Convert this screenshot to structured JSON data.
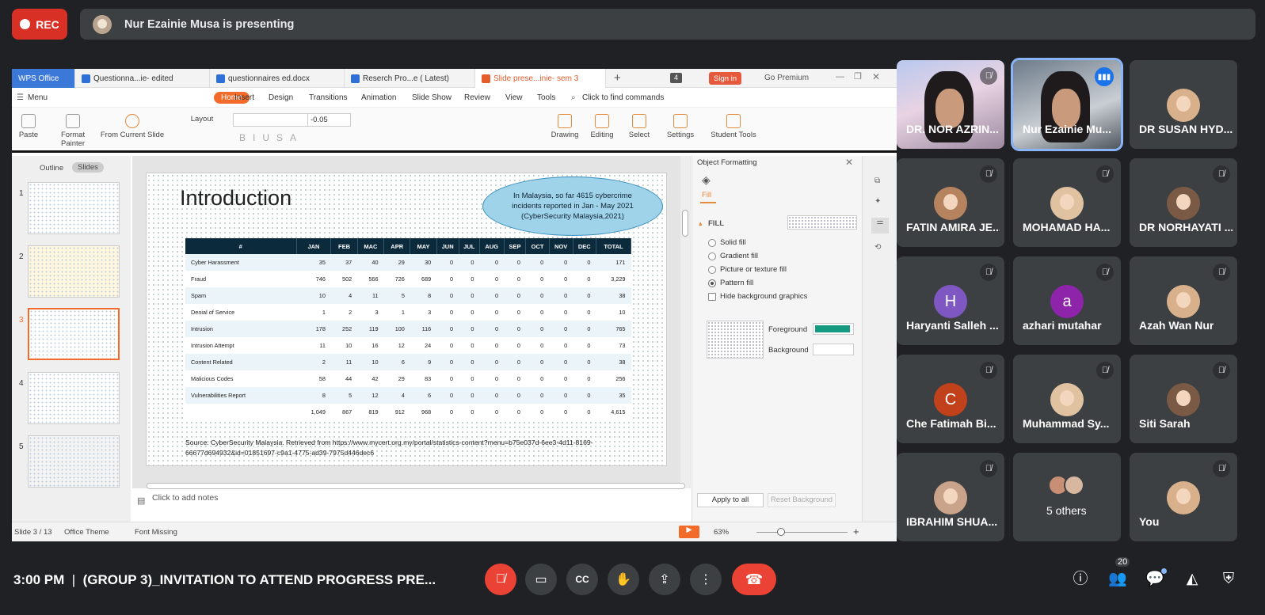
{
  "rec_label": "REC",
  "presenter_text": "Nur Ezainie Musa is presenting",
  "tabs": [
    "WPS Office",
    "Questionna...ie- edited",
    "questionnaires ed.docx",
    "Reserch Pro...e ( Latest)",
    "Slide prese...inie- sem 3"
  ],
  "tab_count": "4",
  "signin": "Sign in",
  "go_premium": "Go Premium",
  "menu": [
    "Menu",
    "Home",
    "Insert",
    "Design",
    "Transitions",
    "Animation",
    "Slide Show",
    "Review",
    "View",
    "Tools",
    "Click to find commands"
  ],
  "ribbon": {
    "paste": "Paste",
    "format_painter": "Format Painter",
    "from_current": "From Current Slide",
    "layout": "Layout",
    "font_size": "-0.05",
    "drawing": "Drawing",
    "editing": "Editing",
    "select": "Select",
    "settings": "Settings",
    "student_tools": "Student Tools"
  },
  "panel": {
    "outline": "Outline",
    "slides": "Slides",
    "nums": [
      "1",
      "2",
      "3",
      "4",
      "5"
    ],
    "add": "+"
  },
  "slide": {
    "title": "Introduction",
    "cloud": "In Malaysia, so far 4615 cybercrime incidents reported in Jan - May 2021 (CyberSecurity Malaysia,2021)",
    "headers": [
      "#",
      "JAN",
      "FEB",
      "MAC",
      "APR",
      "MAY",
      "JUN",
      "JUL",
      "AUG",
      "SEP",
      "OCT",
      "NOV",
      "DEC",
      "TOTAL"
    ],
    "rows": [
      [
        "Cyber Harassment",
        "35",
        "37",
        "40",
        "29",
        "30",
        "0",
        "0",
        "0",
        "0",
        "0",
        "0",
        "0",
        "171"
      ],
      [
        "Fraud",
        "746",
        "502",
        "566",
        "726",
        "689",
        "0",
        "0",
        "0",
        "0",
        "0",
        "0",
        "0",
        "3,229"
      ],
      [
        "Spam",
        "10",
        "4",
        "11",
        "5",
        "8",
        "0",
        "0",
        "0",
        "0",
        "0",
        "0",
        "0",
        "38"
      ],
      [
        "Denial of Service",
        "1",
        "2",
        "3",
        "1",
        "3",
        "0",
        "0",
        "0",
        "0",
        "0",
        "0",
        "0",
        "10"
      ],
      [
        "Intrusion",
        "178",
        "252",
        "119",
        "100",
        "116",
        "0",
        "0",
        "0",
        "0",
        "0",
        "0",
        "0",
        "765"
      ],
      [
        "Intrusion Attempt",
        "11",
        "10",
        "16",
        "12",
        "24",
        "0",
        "0",
        "0",
        "0",
        "0",
        "0",
        "0",
        "73"
      ],
      [
        "Content Related",
        "2",
        "11",
        "10",
        "6",
        "9",
        "0",
        "0",
        "0",
        "0",
        "0",
        "0",
        "0",
        "38"
      ],
      [
        "Malicious Codes",
        "58",
        "44",
        "42",
        "29",
        "83",
        "0",
        "0",
        "0",
        "0",
        "0",
        "0",
        "0",
        "256"
      ],
      [
        "Vulnerabilities Report",
        "8",
        "5",
        "12",
        "4",
        "6",
        "0",
        "0",
        "0",
        "0",
        "0",
        "0",
        "0",
        "35"
      ],
      [
        "",
        "1,049",
        "867",
        "819",
        "912",
        "968",
        "0",
        "0",
        "0",
        "0",
        "0",
        "0",
        "0",
        "4,615"
      ]
    ],
    "source": "Source: CyberSecurity Malaysia. Retrieved from https://www.mycert.org.my/portal/statistics-content?menu=b75e037d-6ee3-4d11-8169-66677d694932&id=01851697-c9a1-4775-ad39-7975d446dec6"
  },
  "notes_placeholder": "Click to add notes",
  "objpane": {
    "title": "Object Formatting",
    "tab": "Fill",
    "fill": "FILL",
    "options": [
      "Solid fill",
      "Gradient fill",
      "Picture or texture fill",
      "Pattern fill",
      "Hide background graphics"
    ],
    "foreground": "Foreground",
    "background": "Background",
    "apply_all": "Apply to all",
    "reset": "Reset Background",
    "fg_color": "#139a80"
  },
  "status": {
    "slide": "Slide 3 / 13",
    "theme": "Office Theme",
    "font_missing": "Font Missing",
    "zoom": "63%"
  },
  "participants": [
    {
      "name": "DR. NOR AZRIN...",
      "muted": true,
      "type": "video"
    },
    {
      "name": "Nur Ezainie Mu...",
      "muted": false,
      "type": "video",
      "speaking": true
    },
    {
      "name": "DR SUSAN HYD...",
      "muted": false,
      "type": "photo"
    },
    {
      "name": "FATIN AMIRA JE...",
      "muted": true,
      "type": "photo"
    },
    {
      "name": "MOHAMAD HA...",
      "muted": true,
      "type": "photo"
    },
    {
      "name": "DR NORHAYATI ...",
      "muted": true,
      "type": "photo"
    },
    {
      "name": "Haryanti Salleh ...",
      "muted": true,
      "type": "letter",
      "letter": "H",
      "color": "#7e57c2"
    },
    {
      "name": "azhari mutahar",
      "muted": true,
      "type": "letter",
      "letter": "a",
      "color": "#8e24aa"
    },
    {
      "name": "Azah Wan Nur",
      "muted": true,
      "type": "photo"
    },
    {
      "name": "Che Fatimah Bi...",
      "muted": true,
      "type": "letter",
      "letter": "C",
      "color": "#c1411b"
    },
    {
      "name": "Muhammad Sy...",
      "muted": true,
      "type": "photo"
    },
    {
      "name": "Siti Sarah",
      "muted": true,
      "type": "photo"
    },
    {
      "name": "IBRAHIM SHUA...",
      "muted": true,
      "type": "photo"
    },
    {
      "name": "5 others",
      "muted": false,
      "type": "others"
    },
    {
      "name": "You",
      "muted": true,
      "type": "photo"
    }
  ],
  "bottom": {
    "time": "3:00 PM",
    "separator": "|",
    "meeting": "(GROUP 3)_INVITATION TO ATTEND PROGRESS PRE...",
    "people_count": "20"
  }
}
